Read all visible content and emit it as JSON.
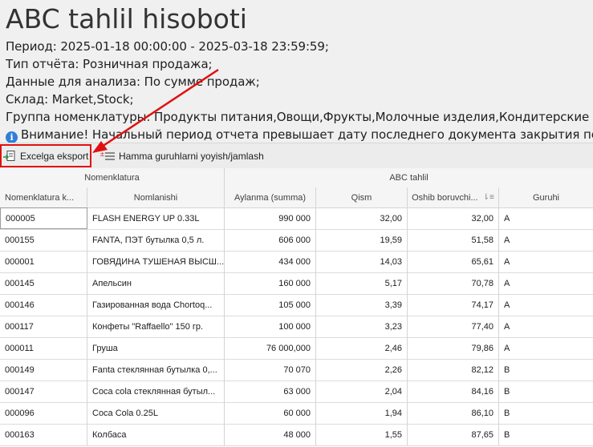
{
  "report": {
    "title": "ABC tahlil hisoboti",
    "lines": [
      {
        "label": "Период:",
        "value": " 2025-01-18 00:00:00 - 2025-03-18 23:59:59;"
      },
      {
        "label": "Тип отчёта:",
        "value": " Розничная продажа;"
      },
      {
        "label": "Данные для анализа:",
        "value": " По сумме продаж;"
      },
      {
        "label": "Склад:",
        "value": " Market,Stock;"
      },
      {
        "label": "Группа номенклатуры:",
        "value": " Продукты питания,Овощи,Фрукты,Молочные изделия,Кондитерские изделия,Мясные"
      }
    ],
    "warning": "Внимание! Начальный период отчета превышает дату последнего документа закрытия периода. Отчет"
  },
  "toolbar": {
    "export_label": "Excelga eksport",
    "group_label": "Hamma guruhlarni yoyish/jamlash"
  },
  "grid": {
    "bands": {
      "nomenclature": "Nomenklatura",
      "abc": "ABC tahlil"
    },
    "columns": {
      "code": "Nomenklatura k...",
      "name": "Nomlanishi",
      "turnover": "Aylanma (summa)",
      "share": "Qism",
      "cumulative": "Oshib boruvchi...",
      "group": "Guruhi"
    },
    "rows": [
      {
        "code": "000005",
        "name": "FLASH ENERGY UP 0.33L",
        "turnover": "990 000",
        "share": "32,00",
        "cumulative": "32,00",
        "group": "A"
      },
      {
        "code": "000155",
        "name": "FANTA, ПЭТ бутылка 0,5 л.",
        "turnover": "606 000",
        "share": "19,59",
        "cumulative": "51,58",
        "group": "A"
      },
      {
        "code": "000001",
        "name": "ГОВЯДИНА ТУШЕНАЯ ВЫСШ...",
        "turnover": "434 000",
        "share": "14,03",
        "cumulative": "65,61",
        "group": "A"
      },
      {
        "code": "000145",
        "name": "Апельсин",
        "turnover": "160 000",
        "share": "5,17",
        "cumulative": "70,78",
        "group": "A"
      },
      {
        "code": "000146",
        "name": "Газированная вода Chortoq...",
        "turnover": "105 000",
        "share": "3,39",
        "cumulative": "74,17",
        "group": "A"
      },
      {
        "code": "000117",
        "name": "Конфеты \"Raffaello\" 150 гр.",
        "turnover": "100 000",
        "share": "3,23",
        "cumulative": "77,40",
        "group": "A"
      },
      {
        "code": "000011",
        "name": "Груша",
        "turnover": "76 000,000",
        "share": "2,46",
        "cumulative": "79,86",
        "group": "A"
      },
      {
        "code": "000149",
        "name": "Fanta стеклянная бутылка 0,...",
        "turnover": "70 070",
        "share": "2,26",
        "cumulative": "82,12",
        "group": "B"
      },
      {
        "code": "000147",
        "name": "Coca cola стеклянная бутыл...",
        "turnover": "63 000",
        "share": "2,04",
        "cumulative": "84,16",
        "group": "B"
      },
      {
        "code": "000096",
        "name": "Coca Cola 0.25L",
        "turnover": "60 000",
        "share": "1,94",
        "cumulative": "86,10",
        "group": "B"
      },
      {
        "code": "000163",
        "name": "Колбаса",
        "turnover": "48 000",
        "share": "1,55",
        "cumulative": "87,65",
        "group": "B"
      }
    ]
  },
  "colors": {
    "highlight": "#e01010",
    "info_icon": "#2f7fd8"
  }
}
